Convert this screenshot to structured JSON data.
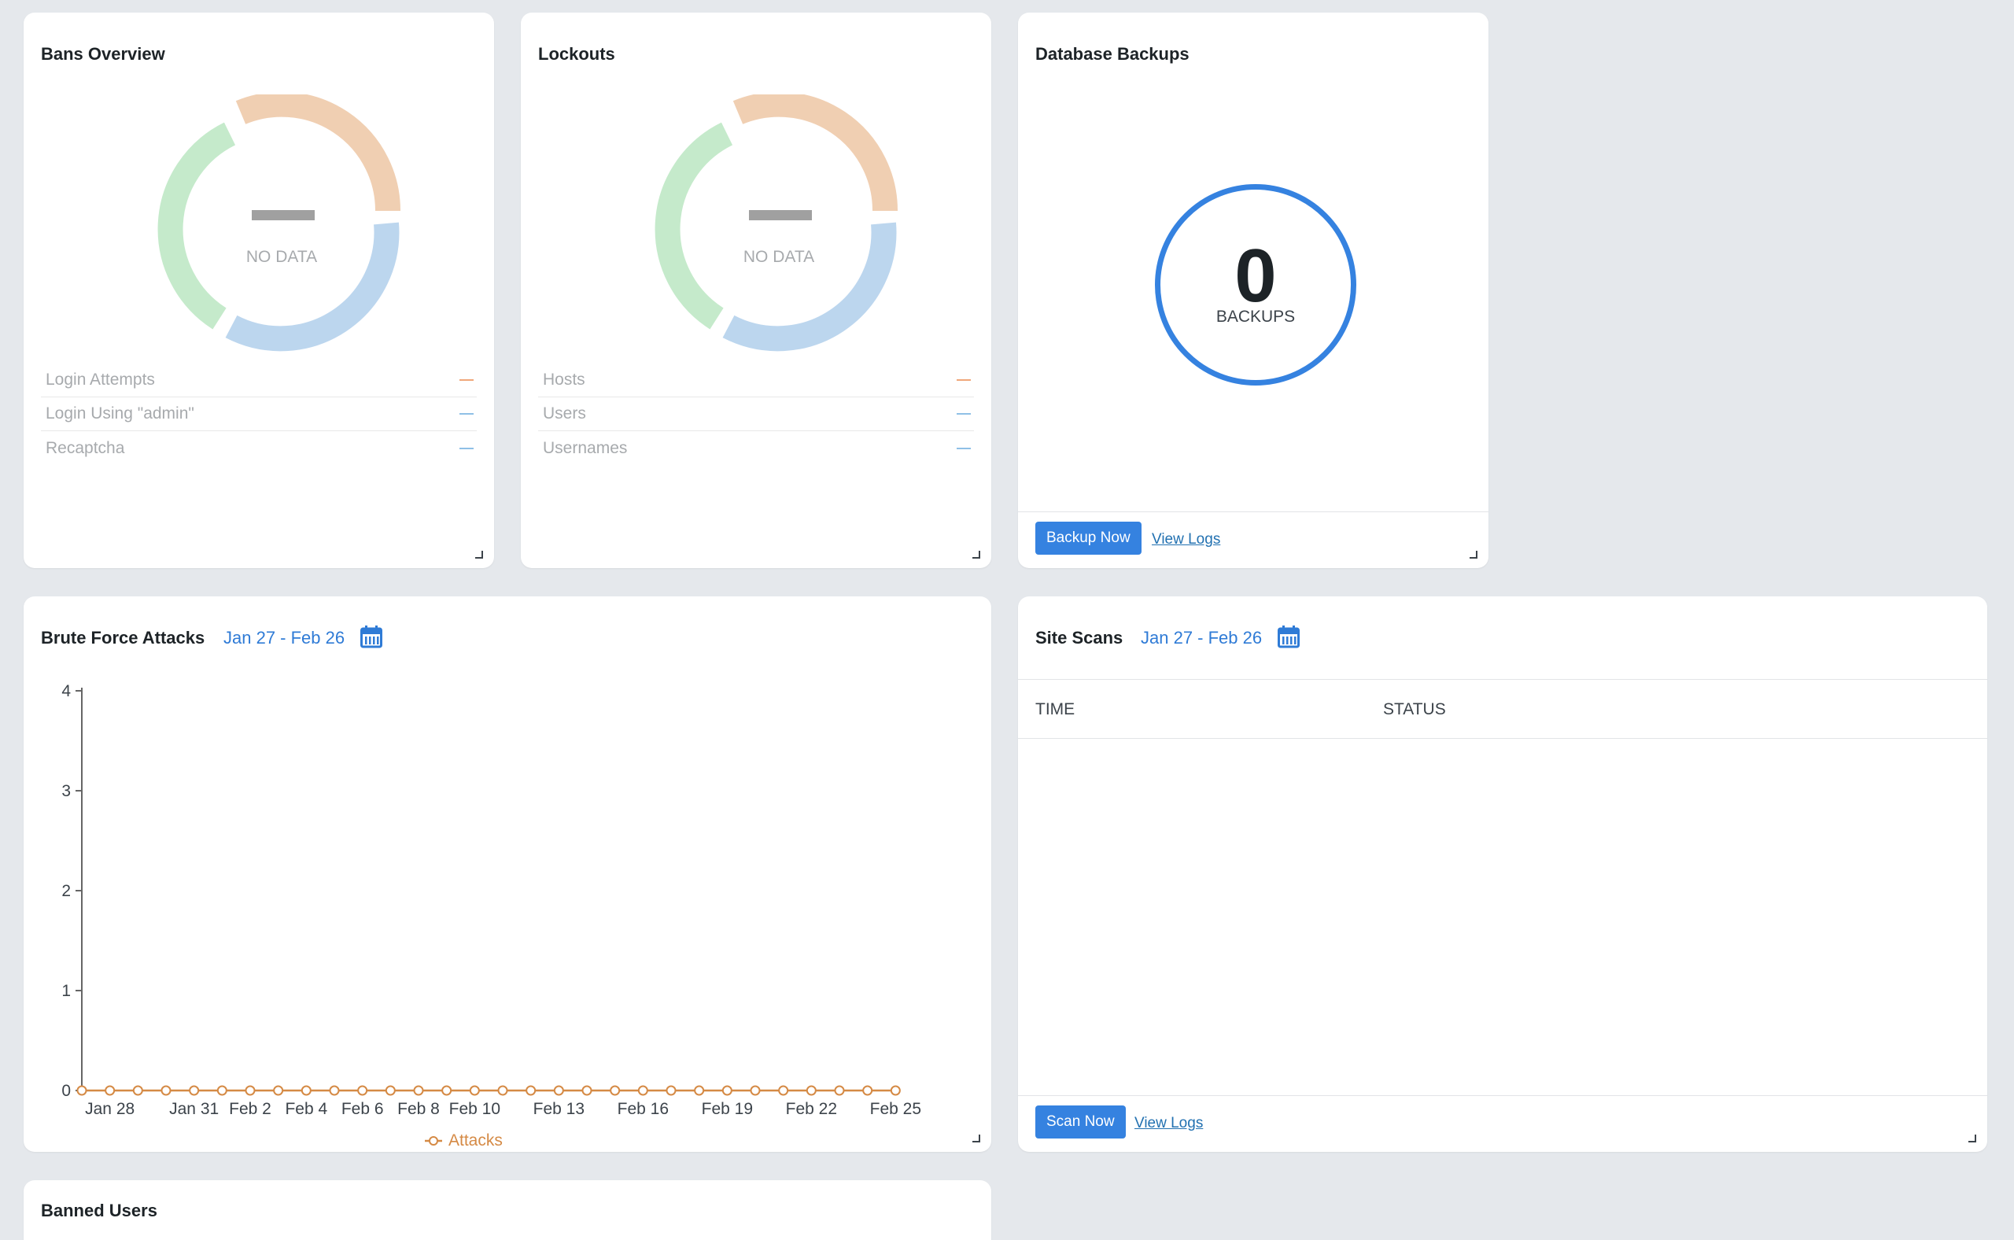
{
  "bans_overview": {
    "title": "Bans Overview",
    "no_data": "NO DATA",
    "legend": [
      {
        "label": "Login Attempts",
        "value": "—",
        "color": "#f0a77a"
      },
      {
        "label": "Login Using \"admin\"",
        "value": "—",
        "color": "#8fc0e6"
      },
      {
        "label": "Recaptcha",
        "value": "—",
        "color": "#8fc0e6"
      }
    ],
    "segment_colors": [
      "#f0cfb2",
      "#bcd6ee",
      "#c5eacb"
    ]
  },
  "lockouts": {
    "title": "Lockouts",
    "no_data": "NO DATA",
    "legend": [
      {
        "label": "Hosts",
        "value": "—",
        "color": "#f0a77a"
      },
      {
        "label": "Users",
        "value": "—",
        "color": "#8fc0e6"
      },
      {
        "label": "Usernames",
        "value": "—",
        "color": "#8fc0e6"
      }
    ],
    "segment_colors": [
      "#f0cfb2",
      "#bcd6ee",
      "#c5eacb"
    ]
  },
  "database_backups": {
    "title": "Database Backups",
    "count": "0",
    "count_label": "BACKUPS",
    "backup_button": "Backup Now",
    "view_logs": "View Logs",
    "accent": "#3582e0"
  },
  "brute_force": {
    "title": "Brute Force Attacks",
    "date_range": "Jan 27 - Feb 26"
  },
  "site_scans": {
    "title": "Site Scans",
    "date_range": "Jan 27 - Feb 26",
    "columns": [
      "TIME",
      "STATUS"
    ],
    "scan_button": "Scan Now",
    "view_logs": "View Logs"
  },
  "banned_users": {
    "title": "Banned Users"
  },
  "chart_data": {
    "type": "line",
    "title": "",
    "xlabel": "",
    "ylabel": "",
    "ylim": [
      0,
      4
    ],
    "yticks": [
      "0",
      "1",
      "2",
      "3",
      "4"
    ],
    "xtick_labels": [
      "Jan 28",
      "Jan 31",
      "Feb 2",
      "Feb 4",
      "Feb 6",
      "Feb 8",
      "Feb 10",
      "Feb 13",
      "Feb 16",
      "Feb 19",
      "Feb 22",
      "Feb 25"
    ],
    "x": [
      "Jan 27",
      "Jan 28",
      "Jan 29",
      "Jan 30",
      "Jan 31",
      "Feb 1",
      "Feb 2",
      "Feb 3",
      "Feb 4",
      "Feb 5",
      "Feb 6",
      "Feb 7",
      "Feb 8",
      "Feb 9",
      "Feb 10",
      "Feb 11",
      "Feb 12",
      "Feb 13",
      "Feb 14",
      "Feb 15",
      "Feb 16",
      "Feb 17",
      "Feb 18",
      "Feb 19",
      "Feb 20",
      "Feb 21",
      "Feb 22",
      "Feb 23",
      "Feb 24",
      "Feb 25"
    ],
    "series": [
      {
        "name": "Attacks",
        "color": "#d58a45",
        "values": [
          0,
          0,
          0,
          0,
          0,
          0,
          0,
          0,
          0,
          0,
          0,
          0,
          0,
          0,
          0,
          0,
          0,
          0,
          0,
          0,
          0,
          0,
          0,
          0,
          0,
          0,
          0,
          0,
          0,
          0
        ]
      }
    ],
    "legend_position": "bottom"
  }
}
